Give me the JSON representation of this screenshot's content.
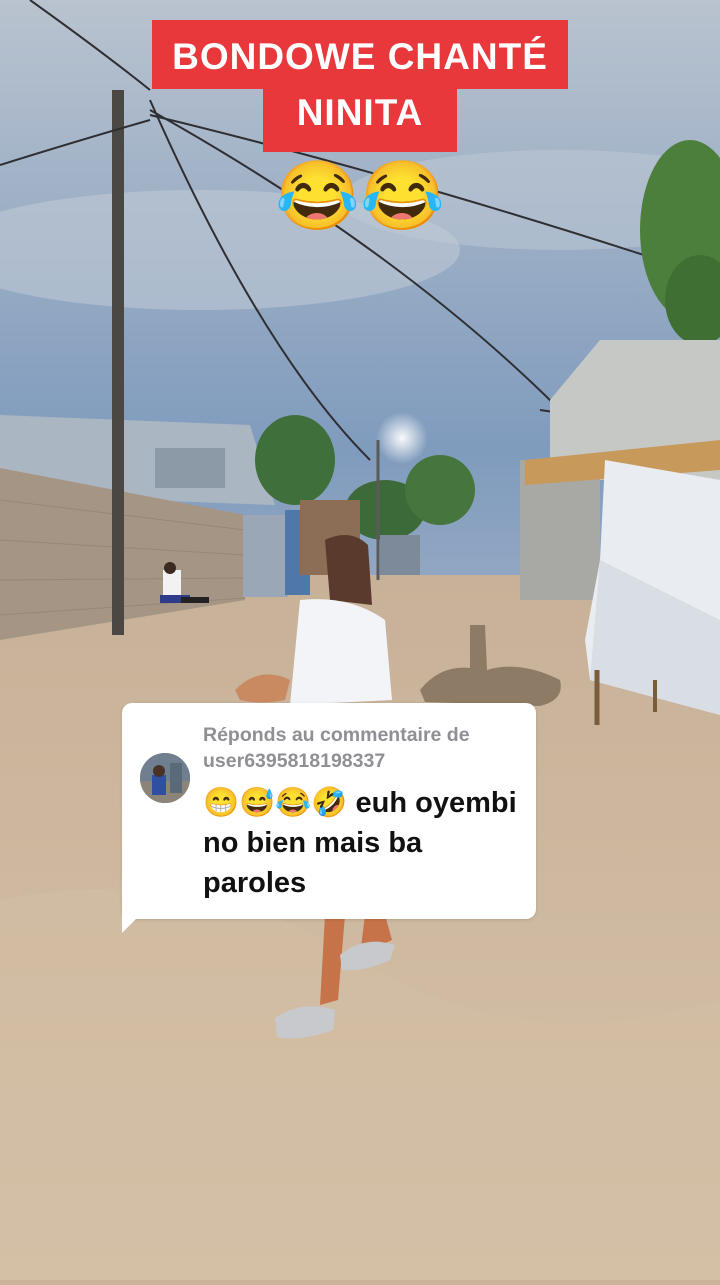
{
  "video": {
    "caption_line1": "BONDOWE CHANTÉ",
    "caption_line2": "NINITA",
    "caption_emojis": "😂😂"
  },
  "reply": {
    "header": "Réponds au commentaire de user6395818198337",
    "comment": "😁😅😂🤣 euh oyembi no bien mais ba paroles"
  }
}
